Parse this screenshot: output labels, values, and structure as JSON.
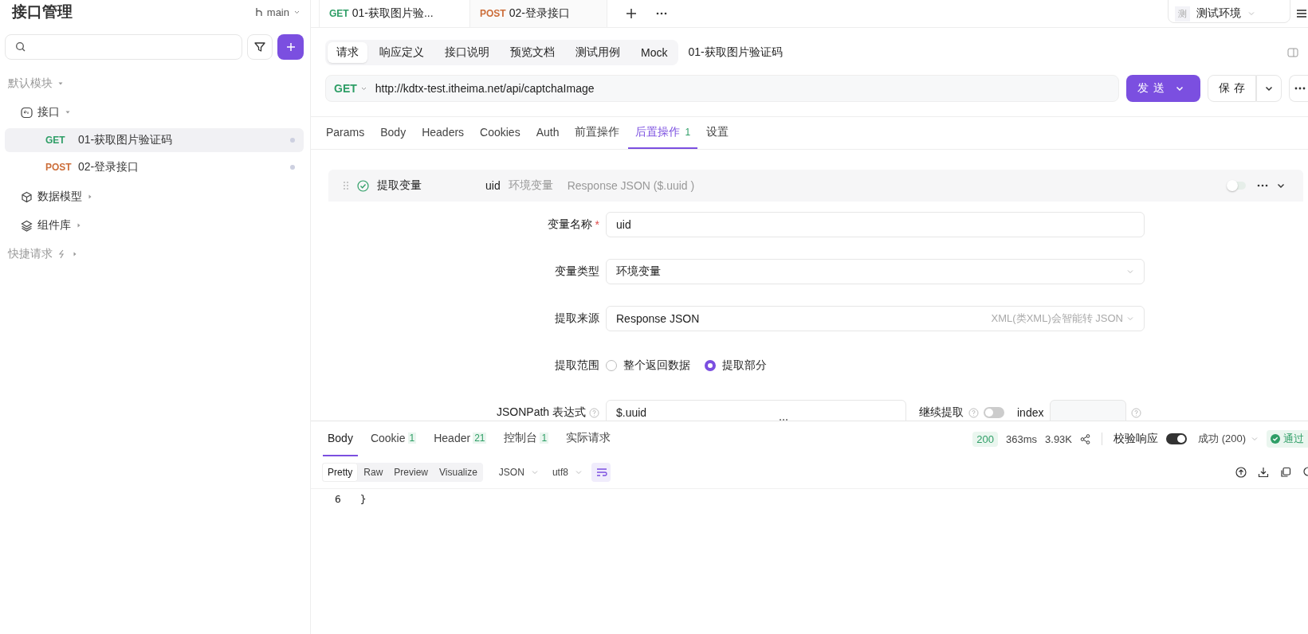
{
  "sidebar": {
    "title": "接口管理",
    "branch": "main",
    "tree": [
      {
        "kind": "module",
        "label": "默认模块",
        "expanded": true,
        "children": [
          {
            "kind": "api",
            "label": "接口",
            "expanded": true,
            "children": [
              {
                "kind": "endpoint",
                "method": "GET",
                "label": "01-获取图片验证码",
                "selected": true
              },
              {
                "kind": "endpoint",
                "method": "POST",
                "label": "02-登录接口",
                "selected": false
              }
            ]
          },
          {
            "kind": "models",
            "label": "数据模型",
            "expanded": false
          },
          {
            "kind": "components",
            "label": "组件库",
            "expanded": false
          }
        ]
      },
      {
        "kind": "quick",
        "label": "快捷请求",
        "expanded": false
      }
    ]
  },
  "tabs": [
    {
      "method": "GET",
      "label": "01-获取图片验...",
      "selected": true
    },
    {
      "method": "POST",
      "label": "02-登录接口",
      "selected": false
    }
  ],
  "environment": {
    "badge": "测",
    "name": "测试环境"
  },
  "request": {
    "views": [
      {
        "label": "请求",
        "selected": true
      },
      {
        "label": "响应定义",
        "selected": false
      },
      {
        "label": "接口说明",
        "selected": false
      },
      {
        "label": "预览文档",
        "selected": false
      },
      {
        "label": "测试用例",
        "selected": false
      },
      {
        "label": "Mock",
        "selected": false
      }
    ],
    "title": "01-获取图片验证码",
    "method": "GET",
    "url": "http://kdtx-test.itheima.net/api/captchaImage",
    "send": "发送",
    "save": "保存",
    "tabs": [
      {
        "label": "Params",
        "selected": false
      },
      {
        "label": "Body",
        "selected": false
      },
      {
        "label": "Headers",
        "selected": false
      },
      {
        "label": "Cookies",
        "selected": false
      },
      {
        "label": "Auth",
        "selected": false
      },
      {
        "label": "前置操作",
        "selected": false
      },
      {
        "label": "后置操作",
        "count": "1",
        "selected": true
      },
      {
        "label": "设置",
        "selected": false
      }
    ],
    "processor": {
      "title": "提取变量",
      "enabled": true,
      "summary_name": "uid",
      "summary_type": "环境变量",
      "summary_source": "Response JSON ($.uuid )",
      "on": false,
      "fields": [
        {
          "kind": "input",
          "label": "变量名称",
          "required_mark": "*",
          "value": "uid"
        },
        {
          "kind": "select",
          "label": "变量类型",
          "value": "环境变量"
        },
        {
          "kind": "select",
          "label": "提取来源",
          "value": "Response JSON",
          "hint": "XML(类XML)会智能转 JSON"
        },
        {
          "kind": "radio",
          "label": "提取范围",
          "options": [
            {
              "label": "整个返回数据",
              "selected": false
            },
            {
              "label": "提取部分",
              "selected": true
            }
          ]
        },
        {
          "kind": "jsonpath",
          "label": "JSONPath 表达式",
          "value": "$.uuid",
          "continue_label": "继续提取",
          "continue_on": false,
          "index_label": "index"
        }
      ]
    }
  },
  "response": {
    "tabs": [
      {
        "label": "Body",
        "selected": true
      },
      {
        "label": "Cookie",
        "count": "1",
        "selected": false
      },
      {
        "label": "Header",
        "count": "21",
        "selected": false
      },
      {
        "label": "控制台",
        "count": "1",
        "selected": false
      },
      {
        "label": "实际请求",
        "selected": false
      }
    ],
    "status": "200",
    "time": "363ms",
    "size": "3.93K",
    "validate_label": "校验响应",
    "validate_on": true,
    "result": "成功 (200)",
    "verdict": "通过",
    "formats": [
      {
        "label": "Pretty",
        "selected": true
      },
      {
        "label": "Raw",
        "selected": false
      },
      {
        "label": "Preview",
        "selected": false
      },
      {
        "label": "Visualize",
        "selected": false
      }
    ],
    "language": "JSON",
    "encoding": "utf8",
    "wrap": true,
    "lines": [
      {
        "number": "6",
        "text": "}"
      }
    ]
  }
}
